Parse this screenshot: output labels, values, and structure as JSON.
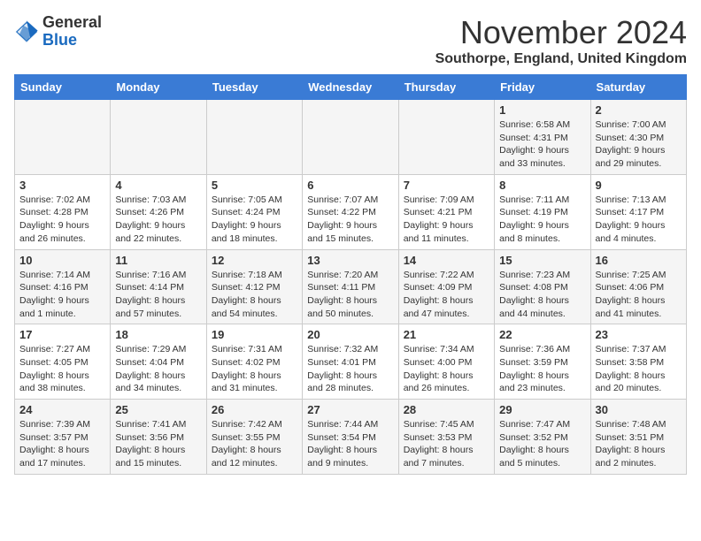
{
  "header": {
    "logo_general": "General",
    "logo_blue": "Blue",
    "month_title": "November 2024",
    "location": "Southorpe, England, United Kingdom"
  },
  "days_of_week": [
    "Sunday",
    "Monday",
    "Tuesday",
    "Wednesday",
    "Thursday",
    "Friday",
    "Saturday"
  ],
  "weeks": [
    [
      {
        "day": "",
        "info": ""
      },
      {
        "day": "",
        "info": ""
      },
      {
        "day": "",
        "info": ""
      },
      {
        "day": "",
        "info": ""
      },
      {
        "day": "",
        "info": ""
      },
      {
        "day": "1",
        "info": "Sunrise: 6:58 AM\nSunset: 4:31 PM\nDaylight: 9 hours and 33 minutes."
      },
      {
        "day": "2",
        "info": "Sunrise: 7:00 AM\nSunset: 4:30 PM\nDaylight: 9 hours and 29 minutes."
      }
    ],
    [
      {
        "day": "3",
        "info": "Sunrise: 7:02 AM\nSunset: 4:28 PM\nDaylight: 9 hours and 26 minutes."
      },
      {
        "day": "4",
        "info": "Sunrise: 7:03 AM\nSunset: 4:26 PM\nDaylight: 9 hours and 22 minutes."
      },
      {
        "day": "5",
        "info": "Sunrise: 7:05 AM\nSunset: 4:24 PM\nDaylight: 9 hours and 18 minutes."
      },
      {
        "day": "6",
        "info": "Sunrise: 7:07 AM\nSunset: 4:22 PM\nDaylight: 9 hours and 15 minutes."
      },
      {
        "day": "7",
        "info": "Sunrise: 7:09 AM\nSunset: 4:21 PM\nDaylight: 9 hours and 11 minutes."
      },
      {
        "day": "8",
        "info": "Sunrise: 7:11 AM\nSunset: 4:19 PM\nDaylight: 9 hours and 8 minutes."
      },
      {
        "day": "9",
        "info": "Sunrise: 7:13 AM\nSunset: 4:17 PM\nDaylight: 9 hours and 4 minutes."
      }
    ],
    [
      {
        "day": "10",
        "info": "Sunrise: 7:14 AM\nSunset: 4:16 PM\nDaylight: 9 hours and 1 minute."
      },
      {
        "day": "11",
        "info": "Sunrise: 7:16 AM\nSunset: 4:14 PM\nDaylight: 8 hours and 57 minutes."
      },
      {
        "day": "12",
        "info": "Sunrise: 7:18 AM\nSunset: 4:12 PM\nDaylight: 8 hours and 54 minutes."
      },
      {
        "day": "13",
        "info": "Sunrise: 7:20 AM\nSunset: 4:11 PM\nDaylight: 8 hours and 50 minutes."
      },
      {
        "day": "14",
        "info": "Sunrise: 7:22 AM\nSunset: 4:09 PM\nDaylight: 8 hours and 47 minutes."
      },
      {
        "day": "15",
        "info": "Sunrise: 7:23 AM\nSunset: 4:08 PM\nDaylight: 8 hours and 44 minutes."
      },
      {
        "day": "16",
        "info": "Sunrise: 7:25 AM\nSunset: 4:06 PM\nDaylight: 8 hours and 41 minutes."
      }
    ],
    [
      {
        "day": "17",
        "info": "Sunrise: 7:27 AM\nSunset: 4:05 PM\nDaylight: 8 hours and 38 minutes."
      },
      {
        "day": "18",
        "info": "Sunrise: 7:29 AM\nSunset: 4:04 PM\nDaylight: 8 hours and 34 minutes."
      },
      {
        "day": "19",
        "info": "Sunrise: 7:31 AM\nSunset: 4:02 PM\nDaylight: 8 hours and 31 minutes."
      },
      {
        "day": "20",
        "info": "Sunrise: 7:32 AM\nSunset: 4:01 PM\nDaylight: 8 hours and 28 minutes."
      },
      {
        "day": "21",
        "info": "Sunrise: 7:34 AM\nSunset: 4:00 PM\nDaylight: 8 hours and 26 minutes."
      },
      {
        "day": "22",
        "info": "Sunrise: 7:36 AM\nSunset: 3:59 PM\nDaylight: 8 hours and 23 minutes."
      },
      {
        "day": "23",
        "info": "Sunrise: 7:37 AM\nSunset: 3:58 PM\nDaylight: 8 hours and 20 minutes."
      }
    ],
    [
      {
        "day": "24",
        "info": "Sunrise: 7:39 AM\nSunset: 3:57 PM\nDaylight: 8 hours and 17 minutes."
      },
      {
        "day": "25",
        "info": "Sunrise: 7:41 AM\nSunset: 3:56 PM\nDaylight: 8 hours and 15 minutes."
      },
      {
        "day": "26",
        "info": "Sunrise: 7:42 AM\nSunset: 3:55 PM\nDaylight: 8 hours and 12 minutes."
      },
      {
        "day": "27",
        "info": "Sunrise: 7:44 AM\nSunset: 3:54 PM\nDaylight: 8 hours and 9 minutes."
      },
      {
        "day": "28",
        "info": "Sunrise: 7:45 AM\nSunset: 3:53 PM\nDaylight: 8 hours and 7 minutes."
      },
      {
        "day": "29",
        "info": "Sunrise: 7:47 AM\nSunset: 3:52 PM\nDaylight: 8 hours and 5 minutes."
      },
      {
        "day": "30",
        "info": "Sunrise: 7:48 AM\nSunset: 3:51 PM\nDaylight: 8 hours and 2 minutes."
      }
    ]
  ]
}
